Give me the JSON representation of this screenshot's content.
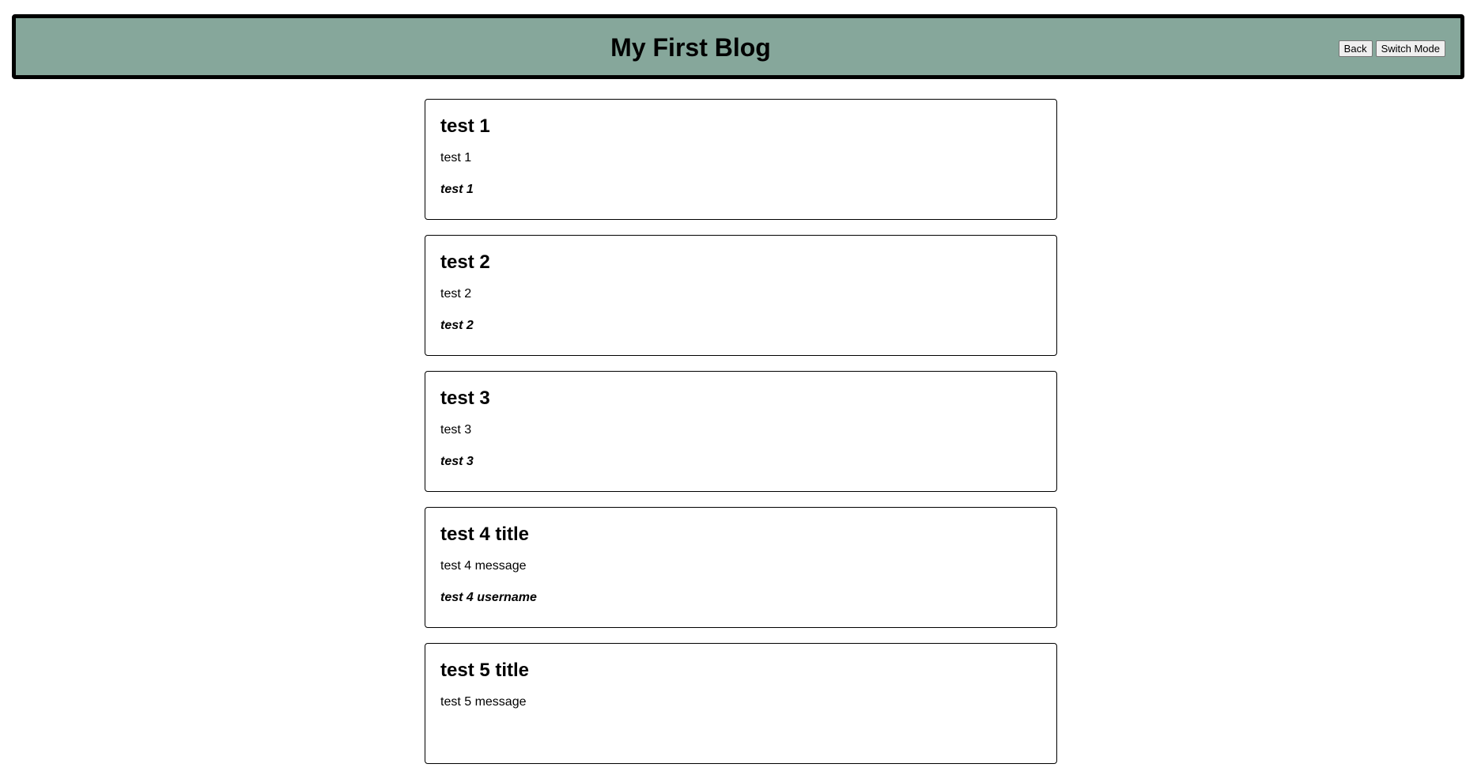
{
  "header": {
    "title": "My First Blog",
    "back_label": "Back",
    "switch_mode_label": "Switch Mode"
  },
  "posts": [
    {
      "title": "test 1",
      "message": "test 1",
      "username": "test 1"
    },
    {
      "title": "test 2",
      "message": "test 2",
      "username": "test 2"
    },
    {
      "title": "test 3",
      "message": "test 3",
      "username": "test 3"
    },
    {
      "title": "test 4 title",
      "message": "test 4 message",
      "username": "test 4 username"
    },
    {
      "title": "test 5 title",
      "message": "test 5 message",
      "username": ""
    }
  ],
  "colors": {
    "header_background": "#86a79b",
    "border": "#000000"
  }
}
